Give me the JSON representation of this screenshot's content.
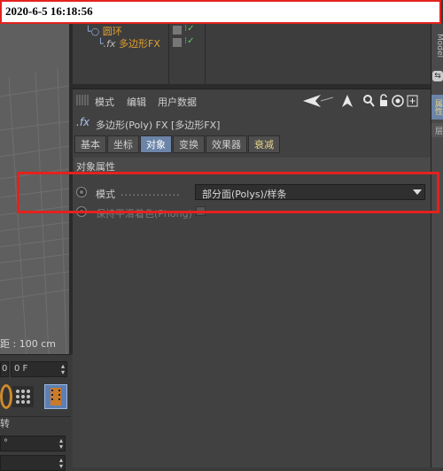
{
  "timestamp": "2020-6-5 16:18:56",
  "viewport": {
    "distance_label": "距 : 100 cm"
  },
  "object_manager": {
    "parent_item": "圆环",
    "child_item": "多边形FX"
  },
  "left_lower": {
    "frame_field_left": "0",
    "frame_field": "0 F",
    "label_partial": "转",
    "field_degree": "°"
  },
  "right_strip": {
    "tab_top": "Model",
    "tab_attr": "属性",
    "tab_layer": "层"
  },
  "attributes": {
    "menu": [
      "模式",
      "编辑",
      "用户数据"
    ],
    "object_title": "多边形(Poly) FX [多边形FX]",
    "tabs": [
      "基本",
      "坐标",
      "对象",
      "变换",
      "效果器",
      "衰减"
    ],
    "active_tab": "对象",
    "section_title": "对象属性",
    "mode_label": "模式",
    "mode_dots": "...............",
    "mode_value": "部分面(Polys)/样条",
    "phong_label": "保持平滑着色(Phong)"
  },
  "colors": {
    "highlight_red": "#e3221e",
    "active_tab": "#6b84a8",
    "decay_tab_text": "#e6d48a"
  }
}
